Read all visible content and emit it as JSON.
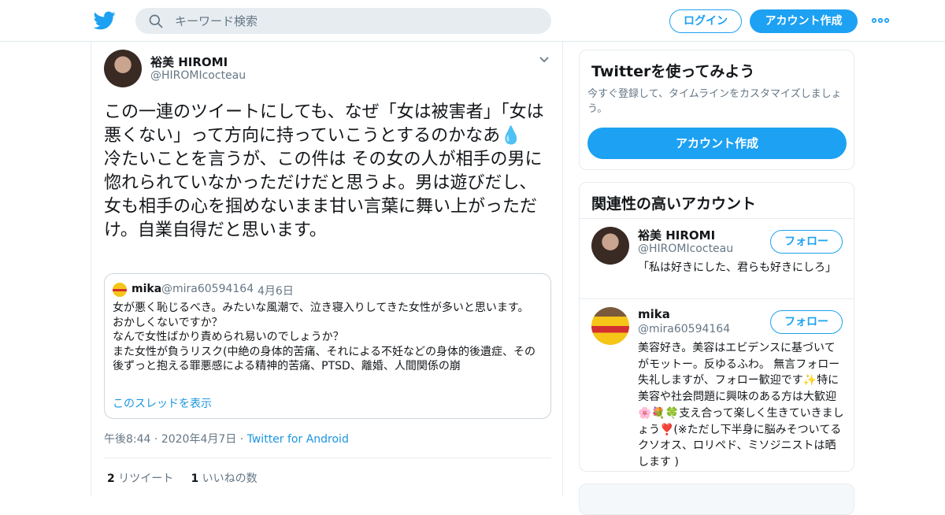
{
  "header": {
    "search_placeholder": "キーワード検索",
    "login_label": "ログイン",
    "signup_label": "アカウント作成"
  },
  "tweet": {
    "author_name": "裕美 HIROMI",
    "author_handle": "@HIROMIcocteau",
    "text": "この一連のツイートにしても、なぜ「女は被害者」「女は悪くない」って方向に持っていこうとするのかなあ💧\n冷たいことを言うが、この件は その女の人が相手の男に惚れられていなかっただけだと思うよ。男は遊びだし、女も相手の心を掴めないまま甘い言葉に舞い上がっただけ。自業自得だと思います。",
    "quote": {
      "name": "mika",
      "handle": "@mira60594164",
      "date": "4月6日",
      "text": "女が悪く恥じるべき。みたいな風潮で、泣き寝入りしてきた女性が多いと思います。\nおかしくないですか？\nなんで女性ばかり責められ易いのでしょうか？\nまた女性が負うリスク(中絶の身体的苦痛、それによる不妊などの身体的後遺症、その後ずっと抱える罪悪感による精神的苦痛、PTSD、離婚、人間関係の崩",
      "thread_link": "このスレッドを表示"
    },
    "time": "午後8:44",
    "date": "2020年4月7日",
    "source": "Twitter for Android",
    "retweets": "2",
    "retweets_label": "リツイート",
    "likes": "1",
    "likes_label": "いいねの数"
  },
  "sidebar": {
    "promo_title": "Twitterを使ってみよう",
    "promo_text": "今すぐ登録して、タイムラインをカスタマイズしましょう。",
    "promo_button": "アカウント作成",
    "related_title": "関連性の高いアカウント",
    "accounts": [
      {
        "name": "裕美 HIROMI",
        "handle": "@HIROMIcocteau",
        "follow_label": "フォロー",
        "bio": "「私は好きにした、君らも好きにしろ」"
      },
      {
        "name": "mika",
        "handle": "@mira60594164",
        "follow_label": "フォロー",
        "bio": "美容好き。美容はエビデンスに基づいてがモットー。反ゆるふわ。 無言フォロー失礼しますが、フォロー歓迎です✨特に美容や社会問題に興味のある方は大歓迎🌸💐🍀支え合って楽しく生きていきましょう❣️(※ただし下半身に脳みそついてるクソオス、ロリペド、ミソジニストは晒します )"
      }
    ]
  },
  "colors": {
    "brand_blue": "#1da1f2",
    "link_blue": "#1b95e0",
    "secondary_text": "#657786",
    "border": "#e6ecf0"
  },
  "icons": [
    "twitter-logo-icon",
    "search-icon",
    "more-icon",
    "chevron-down-icon"
  ]
}
